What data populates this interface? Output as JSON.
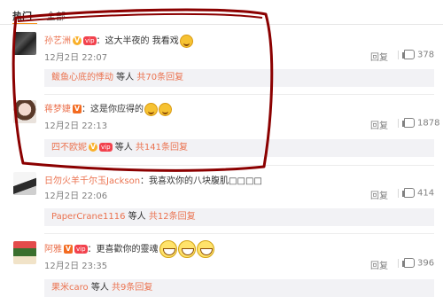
{
  "tabs": {
    "hot": "热门",
    "all": "全部"
  },
  "comments": [
    {
      "user": "孙艺洲",
      "text": "：这大半夜的 我看戏",
      "time": "12月2日 22:07",
      "reply_label": "回复",
      "likes": "378",
      "sub": {
        "name": "鲅鱼心底的悸动",
        "middle": " 等人 ",
        "count": "共70条回复"
      }
    },
    {
      "user": "蒋梦婕",
      "text": "：这是你应得的",
      "time": "12月2日 22:13",
      "reply_label": "回复",
      "likes": "1878",
      "sub": {
        "name": "四不欧妮",
        "middle": " 等人 ",
        "count": "共141条回复"
      }
    },
    {
      "user": "日勿火羊千尔玉Jackson",
      "text": "：我喜欢你的八块腹肌□□□□",
      "time": "12月2日 22:06",
      "reply_label": "回复",
      "likes": "414",
      "sub": {
        "name": "PaperCrane1116",
        "middle": " 等人 ",
        "count": "共12条回复"
      }
    },
    {
      "user": "阿雅",
      "text": "：更喜歡你的靈魂",
      "time": "12月2日 23:35",
      "reply_label": "回复",
      "likes": "396",
      "sub": {
        "name": "果米caro",
        "middle": " 等人 ",
        "count": "共9条回复"
      }
    }
  ],
  "badges": {
    "v": "V",
    "vip": "vip"
  },
  "colors": {
    "accent": "#eb7350",
    "annotation": "#8b0000",
    "subreply_bg": "#f2f2f5"
  },
  "icons": {
    "like": "thumbs-up-icon",
    "verified": "verified-v-icon",
    "member": "vip-badge-icon",
    "emoji": "smile-emoji-icon"
  }
}
